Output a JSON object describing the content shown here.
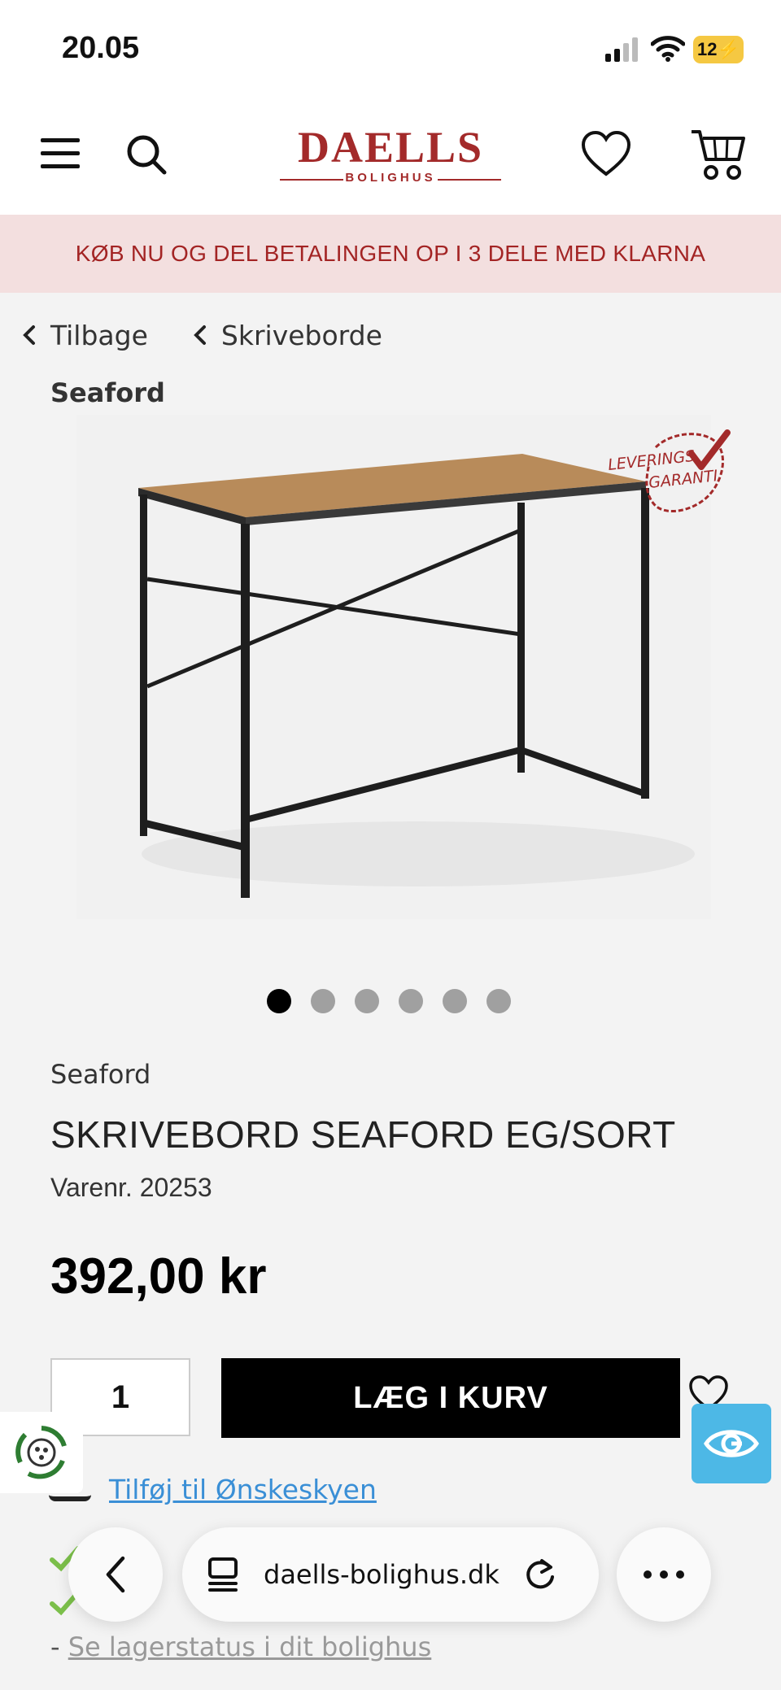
{
  "status_bar": {
    "time": "20.05",
    "battery": "12"
  },
  "header": {
    "logo_main": "DAELLS",
    "logo_sub": "BOLIGHUS",
    "icons": [
      "menu-icon",
      "search-icon",
      "heart-icon",
      "cart-icon"
    ]
  },
  "banner": {
    "text": "KØB NU OG DEL BETALINGEN OP I 3 DELE MED KLARNA"
  },
  "breadcrumb": {
    "back": "Tilbage",
    "category": "Skriveborde"
  },
  "brand_heading": "Seaford",
  "badge": {
    "line1": "LEVERINGS",
    "line2": "GARANTI"
  },
  "gallery": {
    "total": 6,
    "active": 1
  },
  "product": {
    "brand": "Seaford",
    "title": "SKRIVEBORD SEAFORD EG/SORT",
    "sku": "Varenr. 20253",
    "price": "392,00 kr"
  },
  "cart": {
    "quantity": "1",
    "add_label": "LÆG I KURV"
  },
  "wishlist": {
    "label": "Tilføj til Ønskeskyen"
  },
  "stock": {
    "dash": "-",
    "link": "Se lagerstatus i dit bolighus"
  },
  "browser": {
    "url": "daells-bolighus.dk"
  },
  "colors": {
    "brand_red": "#a32a2a",
    "banner_bg": "#f3dfdf",
    "link_blue": "#3a8fd6",
    "widget_blue": "#4db8e6"
  }
}
